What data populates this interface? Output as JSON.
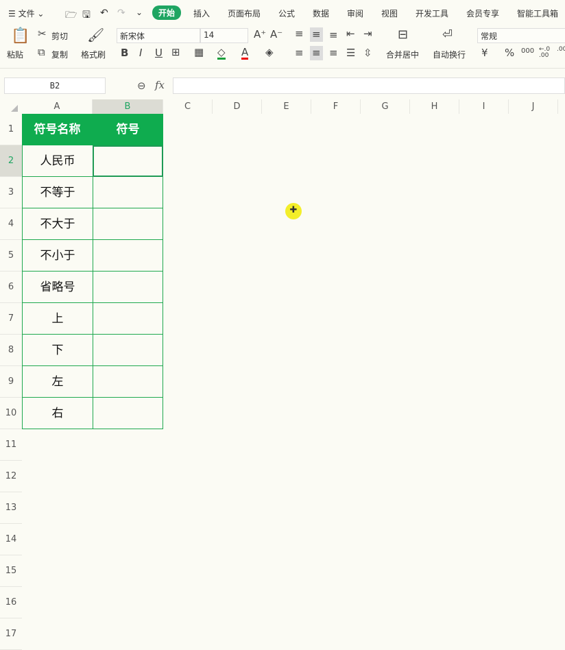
{
  "menu": {
    "file": "文件",
    "tabs": [
      "开始",
      "插入",
      "页面布局",
      "公式",
      "数据",
      "审阅",
      "视图",
      "开发工具",
      "会员专享",
      "智能工具箱"
    ]
  },
  "ribbon": {
    "paste": "粘贴",
    "cut": "剪切",
    "copy": "复制",
    "format_painter": "格式刷",
    "font": "新宋体",
    "size": "14",
    "merge": "合并居中",
    "wrap": "自动换行",
    "number_format": "常规"
  },
  "formula": {
    "cell_ref": "B2",
    "fx": "fx",
    "value": ""
  },
  "columns": [
    "A",
    "B",
    "C",
    "D",
    "E",
    "F",
    "G",
    "H",
    "I",
    "J"
  ],
  "rows": [
    "1",
    "2",
    "3",
    "4",
    "5",
    "6",
    "7",
    "8",
    "9",
    "10",
    "11",
    "12",
    "13",
    "14",
    "15",
    "16",
    "17"
  ],
  "table": {
    "headers": [
      "符号名称",
      "符号"
    ],
    "names": [
      "人民币",
      "不等于",
      "不大于",
      "不小于",
      "省略号",
      "上",
      "下",
      "左",
      "右"
    ]
  },
  "colors": {
    "accent": "#1fa562",
    "header_fill": "#0fac4f"
  }
}
